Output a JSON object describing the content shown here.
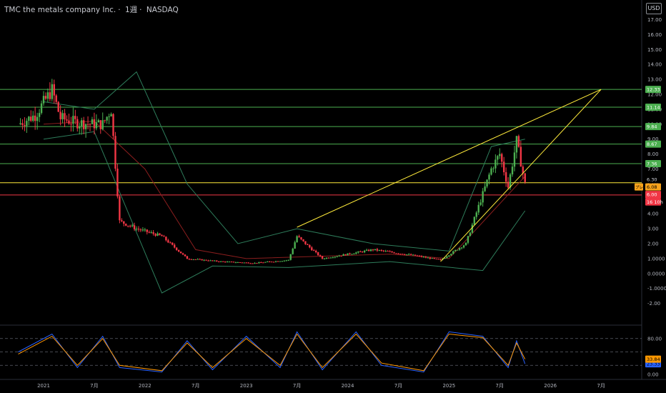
{
  "header": {
    "symbol_name": "TMC the metals company Inc.",
    "interval": "1週",
    "exchange": "NASDAQ",
    "sep": "·",
    "currency_button": "USD"
  },
  "chart_data": [
    {
      "type": "candlestick",
      "title": "TMC the metals company Inc. · 1週 · NASDAQ",
      "x_axis_labels": [
        "2021",
        "7月",
        "2022",
        "7月",
        "2023",
        "7月",
        "2024",
        "7月",
        "2025",
        "7月",
        "2026",
        "7月"
      ],
      "x_axis_label_dates": [
        "2021-01",
        "2021-07",
        "2022-01",
        "2022-07",
        "2023-01",
        "2023-07",
        "2024-01",
        "2024-07",
        "2025-01",
        "2025-07",
        "2026-01",
        "2026-07"
      ],
      "y_axis_ticks": [
        "17.00",
        "16.00",
        "15.00",
        "14.00",
        "13.00",
        "12.00",
        "11.00",
        "10.00",
        "9.00",
        "8.00",
        "7.00",
        "6.00",
        "5.00",
        "4.00",
        "3.00",
        "2.00",
        "1.0000",
        "0.0000",
        "-1.0000",
        "-2.00"
      ],
      "y_range": [
        -2.3,
        17.5
      ],
      "price_path": [
        {
          "date": "2020-10",
          "close": 10.0
        },
        {
          "date": "2020-12",
          "close": 10.6
        },
        {
          "date": "2021-02",
          "close": 12.3
        },
        {
          "date": "2021-03",
          "close": 10.4
        },
        {
          "date": "2021-05",
          "close": 10.1
        },
        {
          "date": "2021-07",
          "close": 10.0
        },
        {
          "date": "2021-08",
          "close": 10.0
        },
        {
          "date": "2021-09",
          "close": 11.0
        },
        {
          "date": "2021-10",
          "close": 3.5
        },
        {
          "date": "2021-12",
          "close": 3.0
        },
        {
          "date": "2022-03",
          "close": 2.5
        },
        {
          "date": "2022-06",
          "close": 1.0
        },
        {
          "date": "2022-10",
          "close": 0.8
        },
        {
          "date": "2023-02",
          "close": 0.7
        },
        {
          "date": "2023-06",
          "close": 0.9
        },
        {
          "date": "2023-07",
          "close": 2.5
        },
        {
          "date": "2023-10",
          "close": 1.0
        },
        {
          "date": "2024-04",
          "close": 1.6
        },
        {
          "date": "2024-09",
          "close": 1.2
        },
        {
          "date": "2024-12",
          "close": 0.9
        },
        {
          "date": "2025-03",
          "close": 2.0
        },
        {
          "date": "2025-06",
          "close": 7.0
        },
        {
          "date": "2025-07",
          "close": 8.0
        },
        {
          "date": "2025-08",
          "close": 5.8
        },
        {
          "date": "2025-09",
          "close": 8.9
        },
        {
          "date": "2025-10",
          "close": 6.0
        }
      ],
      "bollinger_upper": [
        {
          "date": "2021-01",
          "value": 11.5
        },
        {
          "date": "2021-07",
          "value": 11.0
        },
        {
          "date": "2021-12",
          "value": 13.5
        },
        {
          "date": "2022-06",
          "value": 6.0
        },
        {
          "date": "2022-12",
          "value": 2.0
        },
        {
          "date": "2023-07",
          "value": 3.0
        },
        {
          "date": "2024-04",
          "value": 2.0
        },
        {
          "date": "2025-01",
          "value": 1.5
        },
        {
          "date": "2025-06",
          "value": 8.5
        },
        {
          "date": "2025-10",
          "value": 9.0
        }
      ],
      "bollinger_lower": [
        {
          "date": "2021-01",
          "value": 9.0
        },
        {
          "date": "2021-07",
          "value": 9.5
        },
        {
          "date": "2022-03",
          "value": -1.3
        },
        {
          "date": "2022-09",
          "value": 0.5
        },
        {
          "date": "2023-06",
          "value": 0.4
        },
        {
          "date": "2024-06",
          "value": 0.8
        },
        {
          "date": "2025-05",
          "value": 0.2
        },
        {
          "date": "2025-10",
          "value": 4.2
        }
      ],
      "moving_average": [
        {
          "date": "2021-01",
          "value": 10.0
        },
        {
          "date": "2021-07",
          "value": 10.2
        },
        {
          "date": "2022-01",
          "value": 7.0
        },
        {
          "date": "2022-07",
          "value": 1.6
        },
        {
          "date": "2023-01",
          "value": 1.0
        },
        {
          "date": "2024-06",
          "value": 1.3
        },
        {
          "date": "2025-01",
          "value": 1.0
        },
        {
          "date": "2025-10",
          "value": 6.5
        }
      ],
      "horizontal_levels": [
        {
          "price": 12.33,
          "label": "12.33",
          "color": "#4caf50"
        },
        {
          "price": 11.14,
          "label": "11.14",
          "color": "#4caf50"
        },
        {
          "price": 9.84,
          "label": "9.84",
          "color": "#4caf50"
        },
        {
          "price": 8.67,
          "label": "8.67",
          "color": "#4caf50"
        },
        {
          "price": 7.36,
          "label": "7.36",
          "color": "#4caf50"
        },
        {
          "price": 6.08,
          "label": "6.08",
          "color": "#ffeb3b"
        },
        {
          "price": 5.26,
          "label": "5.26",
          "color": "#f23645"
        }
      ],
      "trendlines": [
        {
          "from": {
            "date": "2023-07",
            "price": 3.1
          },
          "to": {
            "date": "2026-07",
            "price": 12.33
          },
          "color": "#ffeb3b"
        },
        {
          "from": {
            "date": "2024-12",
            "price": 0.8
          },
          "to": {
            "date": "2026-07",
            "price": 12.33
          },
          "color": "#ffeb3b"
        }
      ],
      "price_tags": [
        {
          "price": 6.3,
          "label": "6.30",
          "bg": "#000000",
          "fg": "#d1d4dc"
        },
        {
          "price": 6.08,
          "label": "6.08",
          "bg": "#f7a21b",
          "fg": "#000000",
          "prefix": "プレ"
        },
        {
          "price": 5.85,
          "label": "6.00",
          "bg": "#f23645",
          "fg": "#ffffff"
        },
        {
          "price": 5.6,
          "label": "16 10h",
          "bg": "#f23645",
          "fg": "#ffffff"
        }
      ],
      "colors": {
        "up": "#4caf50",
        "down": "#f23645",
        "bollinger": "#2e7d5b",
        "ma": "#8b1e1e",
        "trendline": "#ffeb3b"
      }
    },
    {
      "type": "line",
      "indicator": "stochastic",
      "y_axis_ticks": [
        "80.00",
        "0.00"
      ],
      "y_range": [
        -2,
        102
      ],
      "bands": [
        80,
        50,
        20
      ],
      "series": [
        {
          "color": "#2962ff",
          "last": 23.33,
          "last_label": "23.33",
          "points": [
            {
              "date": "2020-10",
              "value": 50
            },
            {
              "date": "2021-02",
              "value": 90
            },
            {
              "date": "2021-05",
              "value": 15
            },
            {
              "date": "2021-08",
              "value": 85
            },
            {
              "date": "2021-10",
              "value": 15
            },
            {
              "date": "2022-03",
              "value": 5
            },
            {
              "date": "2022-06",
              "value": 75
            },
            {
              "date": "2022-09",
              "value": 10
            },
            {
              "date": "2023-01",
              "value": 85
            },
            {
              "date": "2023-05",
              "value": 15
            },
            {
              "date": "2023-07",
              "value": 95
            },
            {
              "date": "2023-10",
              "value": 10
            },
            {
              "date": "2024-02",
              "value": 95
            },
            {
              "date": "2024-05",
              "value": 20
            },
            {
              "date": "2024-10",
              "value": 5
            },
            {
              "date": "2025-01",
              "value": 95
            },
            {
              "date": "2025-05",
              "value": 85
            },
            {
              "date": "2025-08",
              "value": 15
            },
            {
              "date": "2025-09",
              "value": 75
            },
            {
              "date": "2025-10",
              "value": 23.33
            }
          ]
        },
        {
          "color": "#ff9800",
          "last": 33.84,
          "last_label": "33.84",
          "points": [
            {
              "date": "2020-10",
              "value": 45
            },
            {
              "date": "2021-02",
              "value": 85
            },
            {
              "date": "2021-05",
              "value": 20
            },
            {
              "date": "2021-08",
              "value": 80
            },
            {
              "date": "2021-10",
              "value": 20
            },
            {
              "date": "2022-03",
              "value": 8
            },
            {
              "date": "2022-06",
              "value": 70
            },
            {
              "date": "2022-09",
              "value": 15
            },
            {
              "date": "2023-01",
              "value": 80
            },
            {
              "date": "2023-05",
              "value": 20
            },
            {
              "date": "2023-07",
              "value": 90
            },
            {
              "date": "2023-10",
              "value": 15
            },
            {
              "date": "2024-02",
              "value": 90
            },
            {
              "date": "2024-05",
              "value": 25
            },
            {
              "date": "2024-10",
              "value": 8
            },
            {
              "date": "2025-01",
              "value": 90
            },
            {
              "date": "2025-05",
              "value": 82
            },
            {
              "date": "2025-08",
              "value": 20
            },
            {
              "date": "2025-09",
              "value": 70
            },
            {
              "date": "2025-10",
              "value": 33.84
            }
          ]
        }
      ]
    }
  ]
}
